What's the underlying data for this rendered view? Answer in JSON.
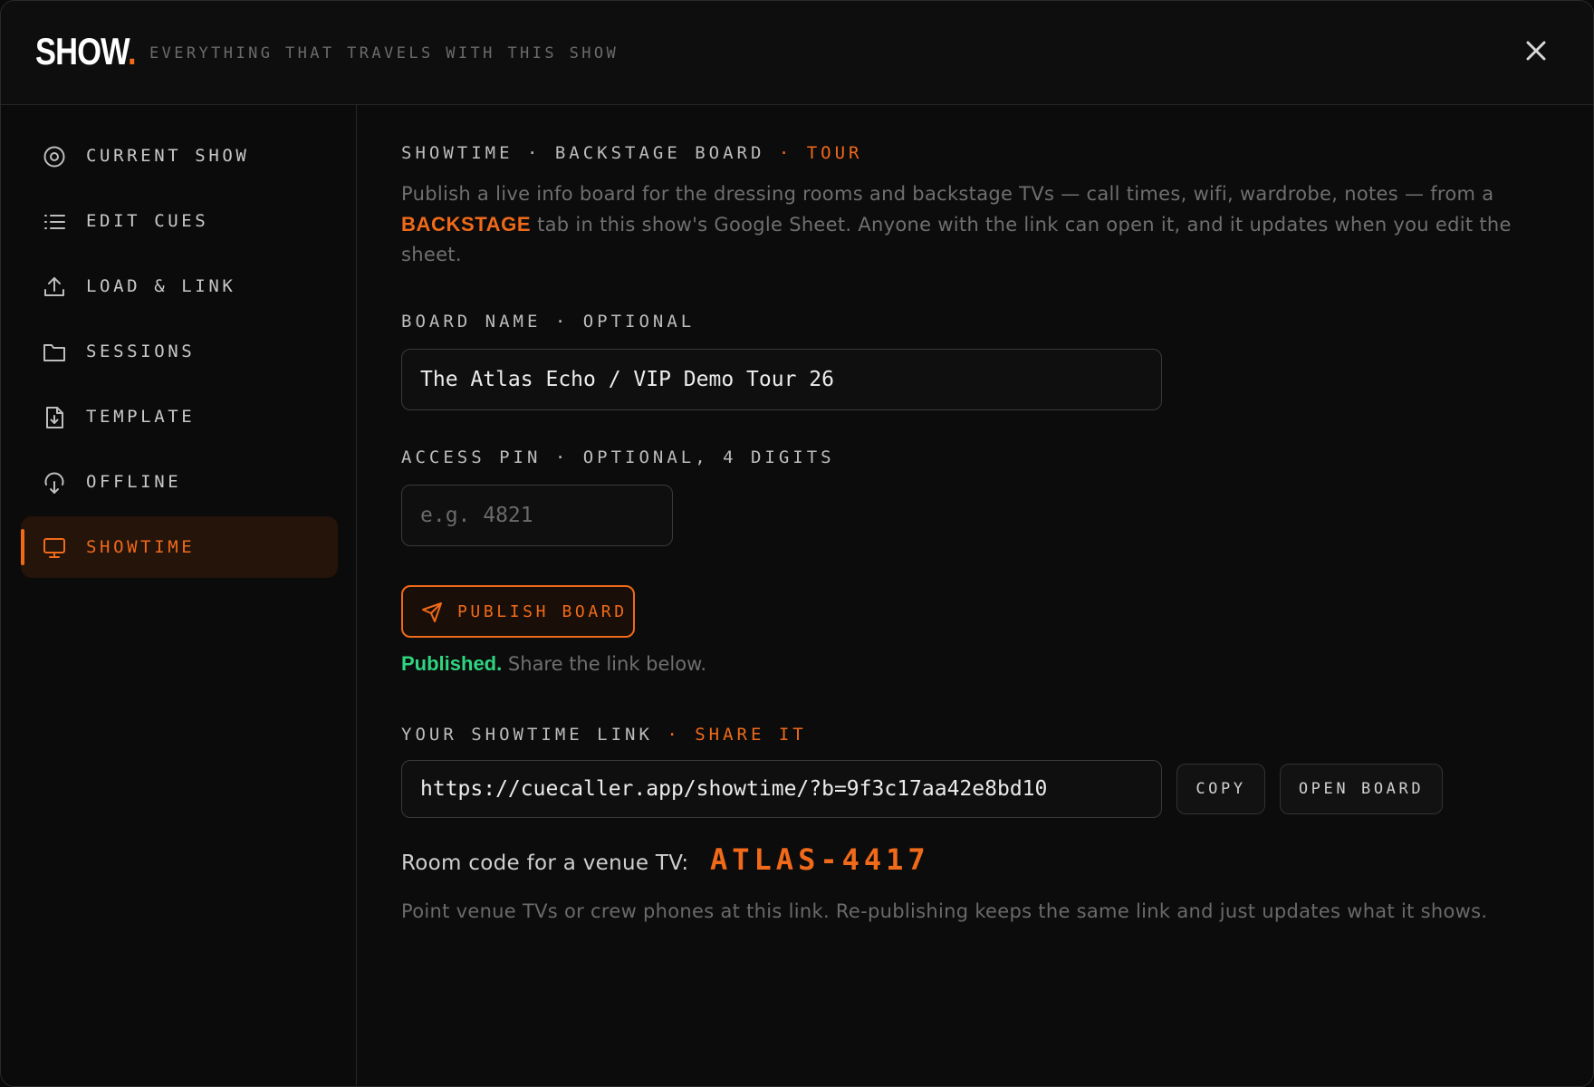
{
  "header": {
    "logo_text": "SHOW",
    "logo_dot": ".",
    "tagline": "EVERYTHING THAT TRAVELS WITH THIS SHOW",
    "close_icon": "close-icon"
  },
  "sidebar": {
    "items": [
      {
        "label": "CURRENT SHOW",
        "icon": "target-icon",
        "active": false
      },
      {
        "label": "EDIT CUES",
        "icon": "list-icon",
        "active": false
      },
      {
        "label": "LOAD & LINK",
        "icon": "upload-icon",
        "active": false
      },
      {
        "label": "SESSIONS",
        "icon": "folder-icon",
        "active": false
      },
      {
        "label": "TEMPLATE",
        "icon": "file-download-icon",
        "active": false
      },
      {
        "label": "OFFLINE",
        "icon": "cloud-download-icon",
        "active": false
      },
      {
        "label": "SHOWTIME",
        "icon": "monitor-icon",
        "active": true
      }
    ]
  },
  "main": {
    "section_title": "SHOWTIME · BACKSTAGE BOARD",
    "section_tag": " · TOUR",
    "description_before": "Publish a live info board for the dressing rooms and backstage TVs — call times, wifi, wardrobe, notes — from a ",
    "description_highlight": "BACKSTAGE",
    "description_after": " tab in this show's Google Sheet. Anyone with the link can open it, and it updates when you edit the sheet.",
    "board_name": {
      "label": "BOARD NAME · OPTIONAL",
      "value": "The Atlas Echo / VIP Demo Tour 26"
    },
    "access_pin": {
      "label": "ACCESS PIN · OPTIONAL, 4 DIGITS",
      "placeholder": "e.g. 4821",
      "value": ""
    },
    "publish_label": "PUBLISH BOARD",
    "status_ok": "Published.",
    "status_text": " Share the link below.",
    "link_label": "YOUR SHOWTIME LINK",
    "link_tag": " · SHARE IT",
    "link_value": "https://cuecaller.app/showtime/?b=9f3c17aa42e8bd10",
    "copy_label": "COPY",
    "open_label": "OPEN BOARD",
    "room_label": "Room code for a venue TV:",
    "room_code": "ATLAS-4417",
    "note": "Point venue TVs or crew phones at this link. Re-publishing keeps the same link and just updates what it shows."
  },
  "colors": {
    "accent": "#f06a1a",
    "success": "#2fd480",
    "background": "#0c0c0c"
  }
}
